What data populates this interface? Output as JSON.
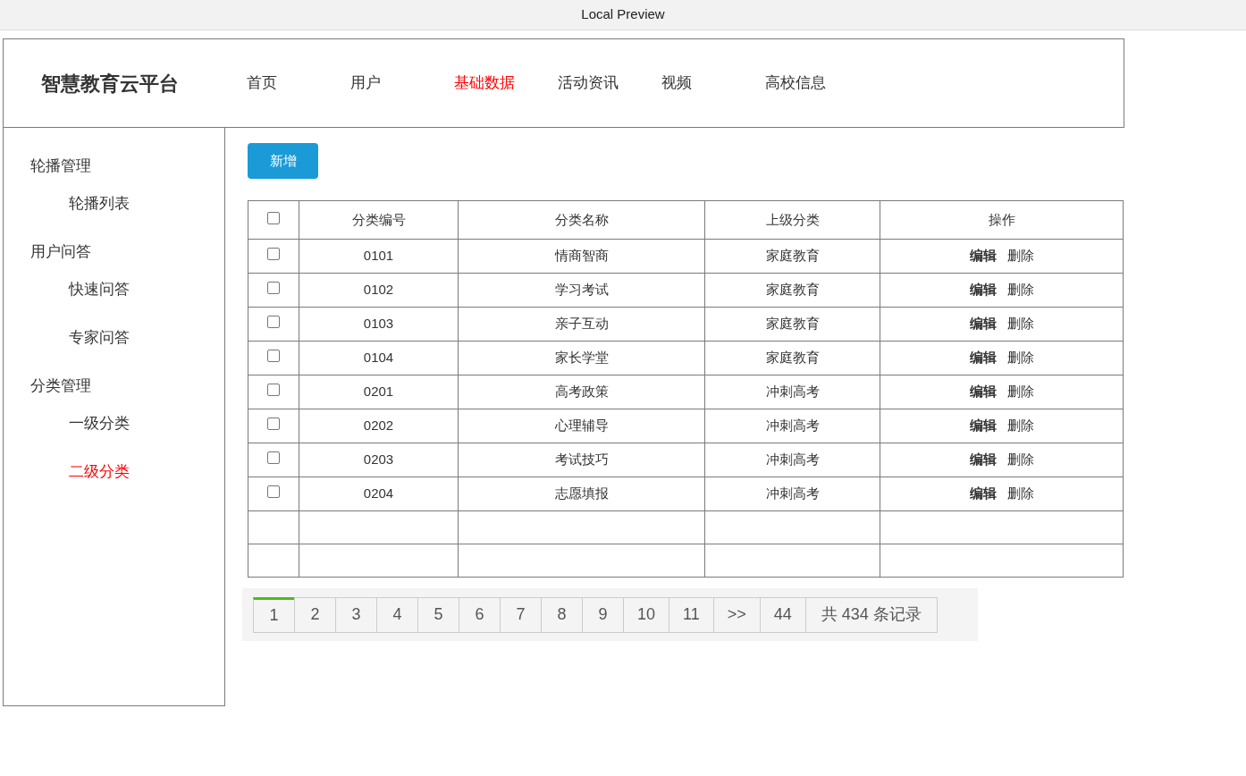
{
  "window": {
    "title": "Local Preview"
  },
  "brand": "智慧教育云平台",
  "nav": [
    {
      "label": "首页",
      "selected": false
    },
    {
      "label": "用户",
      "selected": false
    },
    {
      "label": "基础数据",
      "selected": true
    },
    {
      "label": "活动资讯",
      "selected": false
    },
    {
      "label": "视频",
      "selected": false
    },
    {
      "label": "高校信息",
      "selected": false
    }
  ],
  "sidebar": {
    "groups": [
      {
        "label": "轮播管理",
        "children": [
          {
            "label": "轮播列表",
            "selected": false
          }
        ]
      },
      {
        "label": "用户问答",
        "children": [
          {
            "label": "快速问答",
            "selected": false
          },
          {
            "label": "专家问答",
            "selected": false
          }
        ]
      },
      {
        "label": "分类管理",
        "children": [
          {
            "label": "一级分类",
            "selected": false
          },
          {
            "label": "二级分类",
            "selected": true
          }
        ]
      }
    ]
  },
  "add_button": "新增",
  "table": {
    "select_all_checked": false,
    "columns": [
      "分类编号",
      "分类名称",
      "上级分类",
      "操作"
    ],
    "rows": [
      {
        "checked": false,
        "code": "0101",
        "name": "情商智商",
        "parent": "家庭教育",
        "actions": [
          "编辑",
          "删除"
        ]
      },
      {
        "checked": false,
        "code": "0102",
        "name": "学习考试",
        "parent": "家庭教育",
        "actions": [
          "编辑",
          "删除"
        ]
      },
      {
        "checked": false,
        "code": "0103",
        "name": "亲子互动",
        "parent": "家庭教育",
        "actions": [
          "编辑",
          "删除"
        ]
      },
      {
        "checked": false,
        "code": "0104",
        "name": "家长学堂",
        "parent": "家庭教育",
        "actions": [
          "编辑",
          "删除"
        ]
      },
      {
        "checked": false,
        "code": "0201",
        "name": "高考政策",
        "parent": "冲刺高考",
        "actions": [
          "编辑",
          "删除"
        ]
      },
      {
        "checked": false,
        "code": "0202",
        "name": "心理辅导",
        "parent": "冲刺高考",
        "actions": [
          "编辑",
          "删除"
        ]
      },
      {
        "checked": false,
        "code": "0203",
        "name": "考试技巧",
        "parent": "冲刺高考",
        "actions": [
          "编辑",
          "删除"
        ]
      },
      {
        "checked": false,
        "code": "0204",
        "name": "志愿填报",
        "parent": "冲刺高考",
        "actions": [
          "编辑",
          "删除"
        ]
      }
    ]
  },
  "pagination": {
    "pages": [
      {
        "label": "1",
        "selected": true
      },
      {
        "label": "2",
        "selected": false
      },
      {
        "label": "3",
        "selected": false
      },
      {
        "label": "4",
        "selected": false
      },
      {
        "label": "5",
        "selected": false
      },
      {
        "label": "6",
        "selected": false
      },
      {
        "label": "7",
        "selected": false
      },
      {
        "label": "8",
        "selected": false
      },
      {
        "label": "9",
        "selected": false
      },
      {
        "label": "10",
        "selected": false
      },
      {
        "label": "11",
        "selected": false
      },
      {
        "label": ">>",
        "selected": false
      },
      {
        "label": "44",
        "selected": false
      }
    ],
    "total": "共 434 条记录"
  }
}
